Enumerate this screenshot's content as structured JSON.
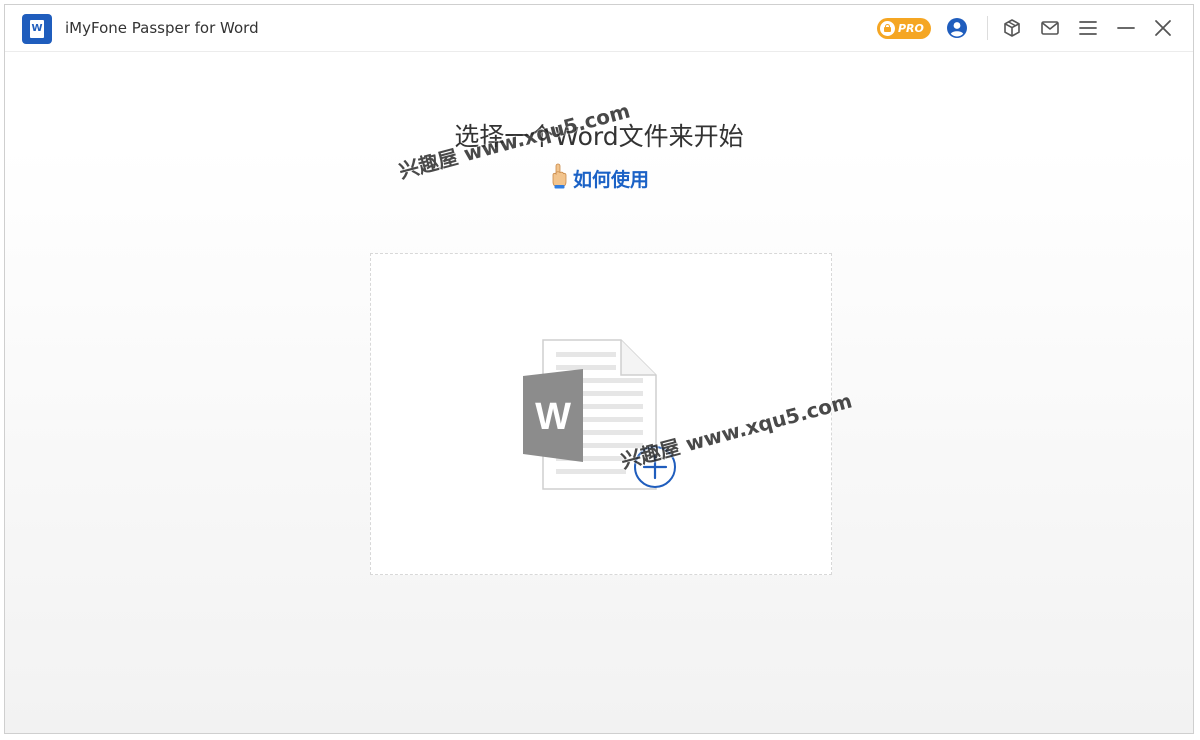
{
  "window": {
    "title": "iMyFone Passper for Word",
    "logo_letter": "W"
  },
  "toolbar": {
    "pro_label": "PRO",
    "icons": [
      "lock-icon",
      "account-icon",
      "package-icon",
      "mail-icon",
      "menu-icon",
      "minimize-icon",
      "close-icon"
    ]
  },
  "main": {
    "heading": "选择一个Word文件来开始",
    "how_to_use": "如何使用",
    "file_icon_letter": "W"
  },
  "watermarks": [
    "兴趣屋 www.xqu5.com",
    "兴趣屋 www.xqu5.com"
  ],
  "colors": {
    "brand_blue": "#1f5dbd",
    "link_blue": "#1b62c6",
    "pro_orange": "#f5a623",
    "word_gray": "#8c8c8c"
  }
}
